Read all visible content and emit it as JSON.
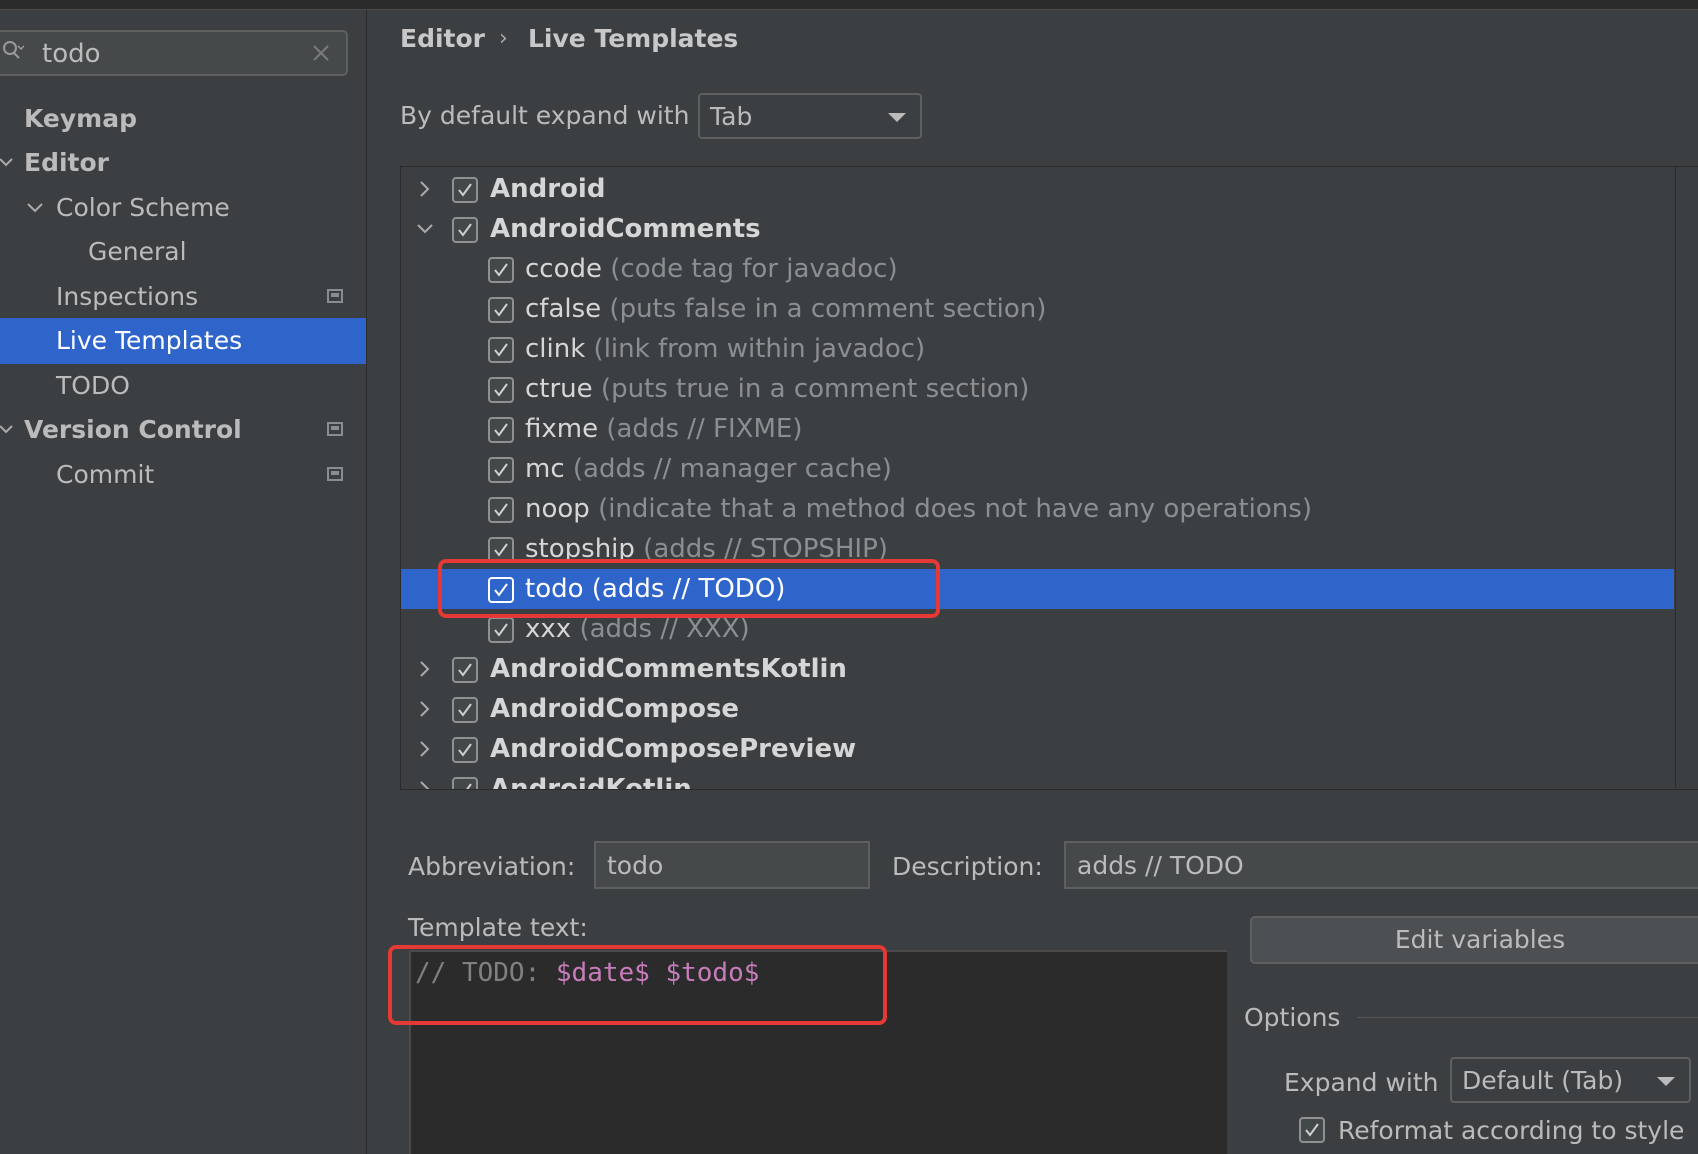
{
  "search": {
    "value": "todo"
  },
  "nav": {
    "items": [
      {
        "label": "Keymap"
      },
      {
        "label": "Editor"
      },
      {
        "label": "Color Scheme"
      },
      {
        "label": "General"
      },
      {
        "label": "Inspections"
      },
      {
        "label": "Live Templates"
      },
      {
        "label": "TODO"
      },
      {
        "label": "Version Control"
      },
      {
        "label": "Commit"
      }
    ]
  },
  "breadcrumb": {
    "parent": "Editor",
    "current": "Live Templates"
  },
  "expand_default": {
    "label": "By default expand with",
    "value": "Tab"
  },
  "tree": {
    "groups": [
      {
        "name": "Android",
        "expanded": false,
        "checked": true
      },
      {
        "name": "AndroidComments",
        "expanded": true,
        "checked": true
      },
      {
        "name": "AndroidCommentsKotlin",
        "expanded": false,
        "checked": true
      },
      {
        "name": "AndroidCompose",
        "expanded": false,
        "checked": true
      },
      {
        "name": "AndroidComposePreview",
        "expanded": false,
        "checked": true
      },
      {
        "name": "AndroidKotlin",
        "expanded": false,
        "checked": true
      }
    ],
    "templates": [
      {
        "abbr": "ccode",
        "desc": "(code tag for javadoc)",
        "checked": true
      },
      {
        "abbr": "cfalse",
        "desc": "(puts false in a comment section)",
        "checked": true
      },
      {
        "abbr": "clink",
        "desc": "(link from within javadoc)",
        "checked": true
      },
      {
        "abbr": "ctrue",
        "desc": "(puts true in a comment section)",
        "checked": true
      },
      {
        "abbr": "fixme",
        "desc": "(adds // FIXME)",
        "checked": true
      },
      {
        "abbr": "mc",
        "desc": "(adds // manager cache)",
        "checked": true
      },
      {
        "abbr": "noop",
        "desc": "(indicate that a method does not have any operations)",
        "checked": true
      },
      {
        "abbr": "stopship",
        "desc": "(adds // STOPSHIP)",
        "checked": true
      },
      {
        "abbr": "todo",
        "desc": "(adds // TODO)",
        "checked": true,
        "selected": true
      },
      {
        "abbr": "xxx",
        "desc": "(adds // XXX)",
        "checked": true
      }
    ]
  },
  "details": {
    "abbreviation_label": "Abbreviation:",
    "abbreviation_value": "todo",
    "description_label": "Description:",
    "description_value": "adds // TODO",
    "template_text_label": "Template text:",
    "template_comment": "// TODO: ",
    "template_var1": "$date$",
    "template_space": " ",
    "template_var2": "$todo$",
    "edit_variables_label": "Edit variables",
    "options_label": "Options",
    "expand_with_label": "Expand with",
    "expand_with_value": "Default (Tab)",
    "reformat_label": "Reformat according to style",
    "reformat_checked": true
  },
  "colors": {
    "selection": "#2f65ca",
    "highlight_box": "#e53935",
    "template_variable": "#c77dbb"
  }
}
